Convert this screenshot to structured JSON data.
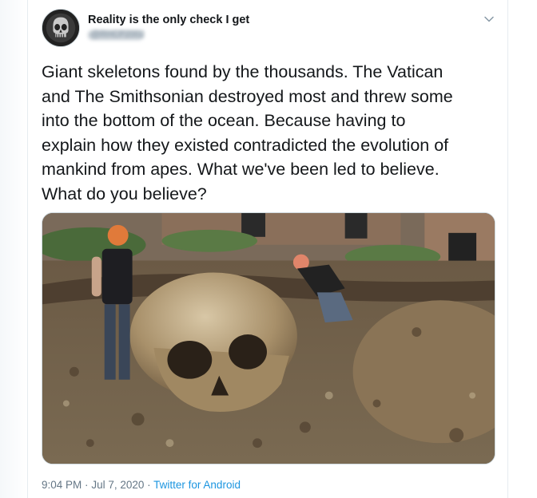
{
  "tweet": {
    "author": {
      "display_name": "Reality is the only check I get",
      "handle": "@RHCP2002",
      "avatar_icon": "punisher-skull-icon"
    },
    "menu_icon": "chevron-down-icon",
    "text": "Giant skeletons found by the thousands. The Vatican\nand The Smithsonian destroyed most and threw some\ninto the bottom of the ocean. Because having to\nexplain how they existed contradicted the evolution of\nmankind from apes. What we've been led to believe.\nWhat do you believe?",
    "time": "9:04 PM",
    "separator": "·",
    "date": "Jul 7, 2020",
    "source": "Twitter for Android"
  },
  "colors": {
    "text": "#14171a",
    "muted": "#657786",
    "link": "#1b95e0",
    "border": "#e6ecf0"
  }
}
